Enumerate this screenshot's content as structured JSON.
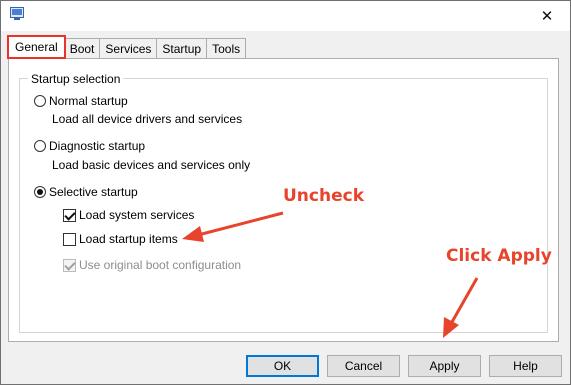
{
  "window": {
    "close_glyph": "✕",
    "app_icon": "msconfig-icon"
  },
  "tabs": [
    {
      "label": "General",
      "active": true
    },
    {
      "label": "Boot",
      "active": false
    },
    {
      "label": "Services",
      "active": false
    },
    {
      "label": "Startup",
      "active": false
    },
    {
      "label": "Tools",
      "active": false
    }
  ],
  "startup_selection": {
    "legend": "Startup selection",
    "normal": {
      "label": "Normal startup",
      "description": "Load all device drivers and services",
      "checked": false
    },
    "diagnostic": {
      "label": "Diagnostic startup",
      "description": "Load basic devices and services only",
      "checked": false
    },
    "selective": {
      "label": "Selective startup",
      "checked": true,
      "options": [
        {
          "label": "Load system services",
          "checked": true,
          "disabled": false
        },
        {
          "label": "Load startup items",
          "checked": false,
          "disabled": false
        },
        {
          "label": "Use original boot configuration",
          "checked": true,
          "disabled": true
        }
      ]
    }
  },
  "annotations": {
    "uncheck": "Uncheck",
    "apply": "Click Apply",
    "color": "#e8432b"
  },
  "buttons": {
    "ok": "OK",
    "cancel": "Cancel",
    "apply": "Apply",
    "help": "Help"
  },
  "colors": {
    "highlight": "#e8322a",
    "default_button_border": "#0078d7"
  }
}
